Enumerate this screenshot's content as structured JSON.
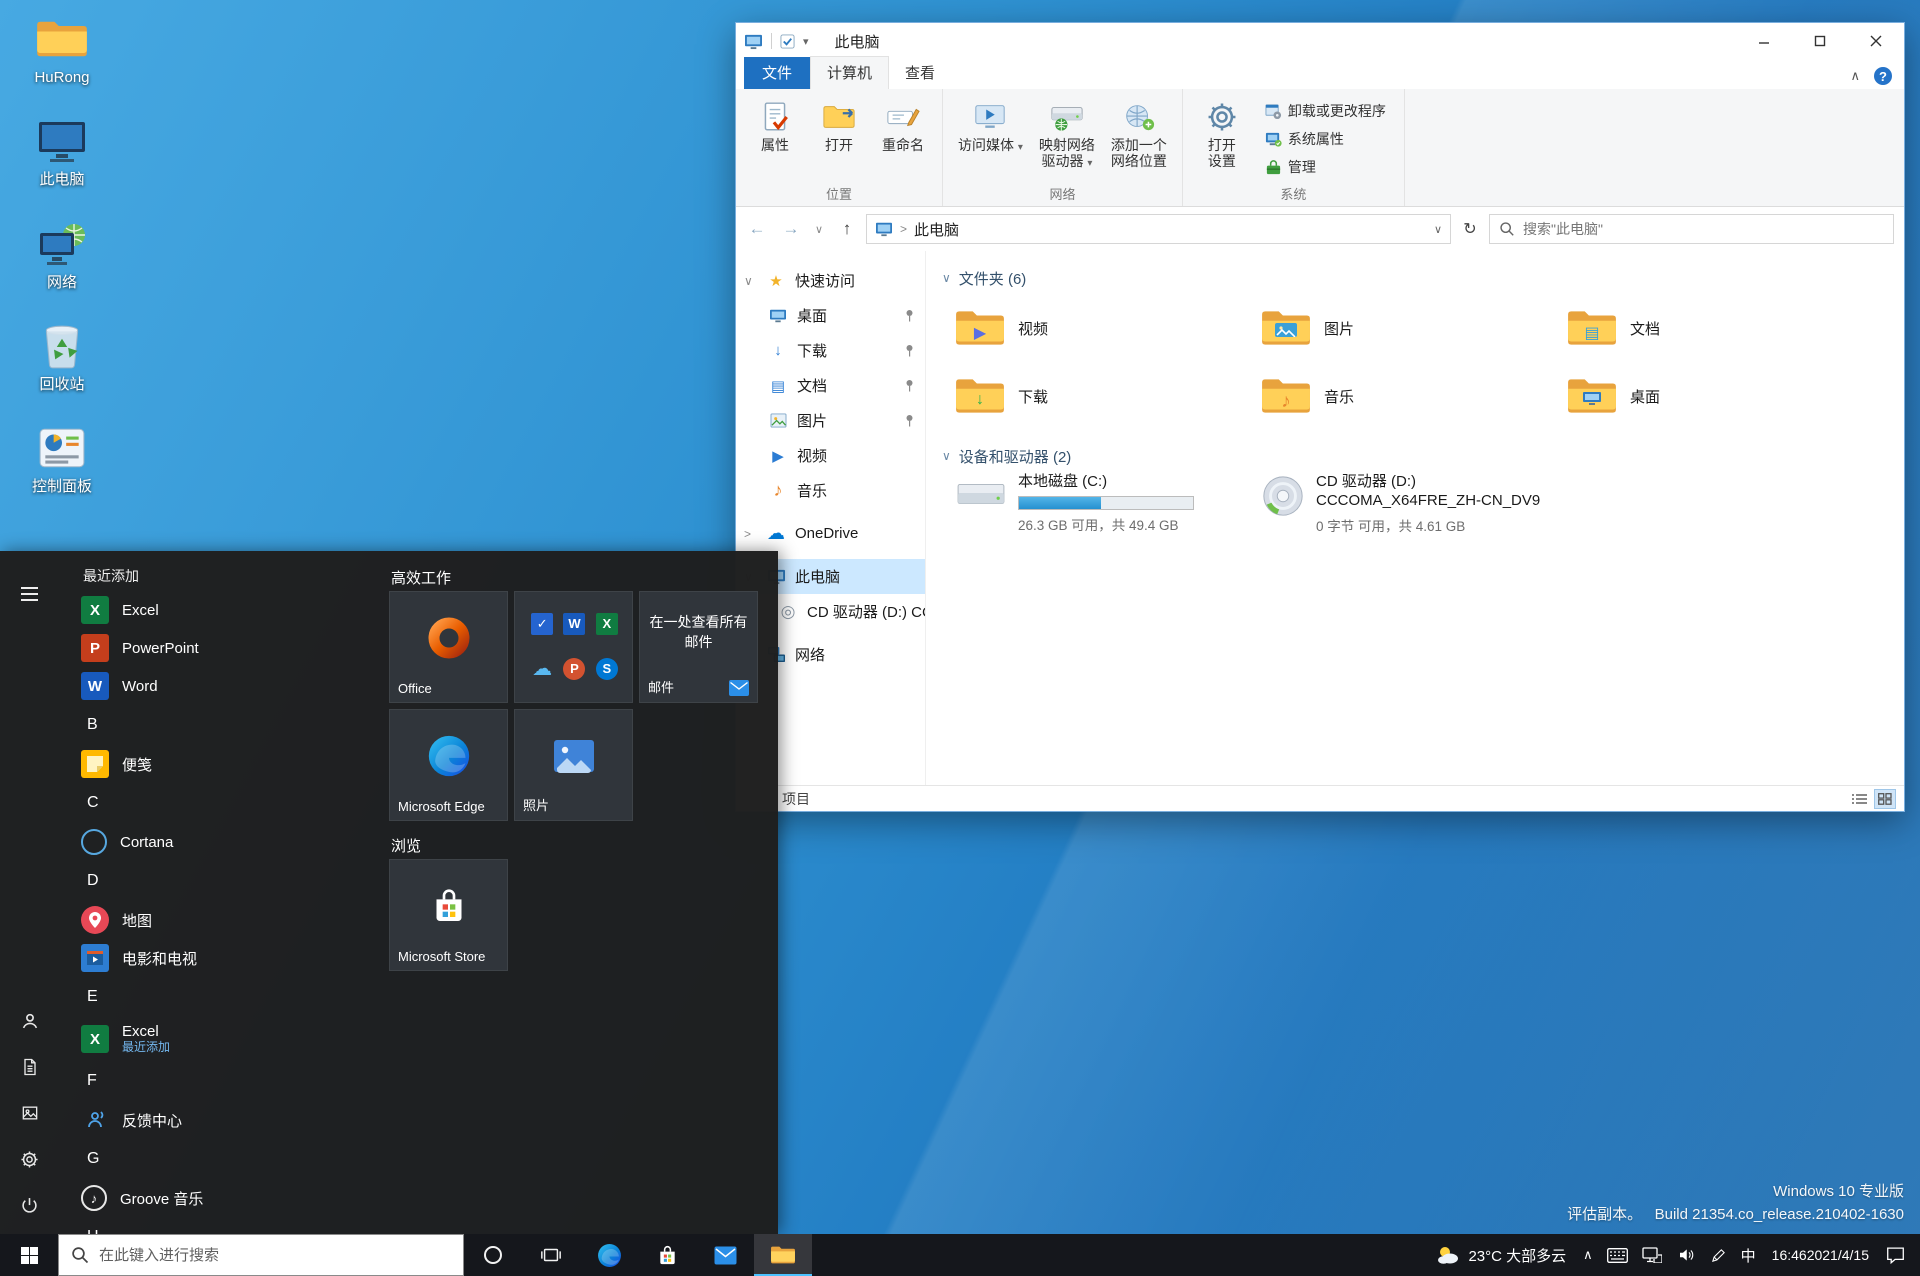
{
  "colors": {
    "accent_blue": "#0078d7",
    "desktop_blue": "#2f92d2",
    "file_tab_blue": "#1e70c1",
    "drive_bar_blue": "#2590d0",
    "folder_yellow": "#ffd058",
    "start_menu_bg": "#1e1e1e",
    "taskbar_bg": "#15171c",
    "taskbar_active_underline": "#4cc2ff"
  },
  "glyphs": {
    "back": "←",
    "forward": "→",
    "up": "↑",
    "refresh": "↻",
    "dropdown": "▾",
    "chev_down": "∨",
    "chev_right": ">",
    "ribbon_collapse": "∧",
    "help": "?",
    "tray_overflow": "∧",
    "play": "▶",
    "down": "↓",
    "music": "♪",
    "doc": "▤",
    "cd": "◎",
    "star": "★",
    "cloud": "☁"
  },
  "desktop": {
    "icons": [
      {
        "label": "HuRong"
      },
      {
        "label": "此电脑"
      },
      {
        "label": "网络"
      },
      {
        "label": "回收站"
      },
      {
        "label": "控制面板"
      }
    ],
    "winver": {
      "line1": "Windows 10 专业版",
      "line2a": "评估副本。",
      "line2b": "Build 21354.co_release.210402-1630"
    }
  },
  "explorer": {
    "title": "此电脑",
    "tabs": {
      "file": "文件",
      "computer": "计算机",
      "view": "查看"
    },
    "ribbon": {
      "properties": "属性",
      "open": "打开",
      "rename": "重命名",
      "group_location": "位置",
      "access_media": "访问媒体",
      "map_drive_l1": "映射网络",
      "map_drive_l2": "驱动器",
      "add_network_l1": "添加一个",
      "add_network_l2": "网络位置",
      "group_network": "网络",
      "open_settings_l1": "打开",
      "open_settings_l2": "设置",
      "uninstall": "卸载或更改程序",
      "system_properties": "系统属性",
      "manage": "管理",
      "group_system": "系统"
    },
    "address": {
      "crumb": "此电脑",
      "search_placeholder": "搜索\"此电脑\""
    },
    "nav": {
      "quick_access": "快速访问",
      "desktop": "桌面",
      "downloads": "下载",
      "documents": "文档",
      "pictures": "图片",
      "videos": "视频",
      "music": "音乐",
      "onedrive": "OneDrive",
      "this_pc": "此电脑",
      "cd_drive": "CD 驱动器 (D:) CCC",
      "network": "网络"
    },
    "section_folders": "文件夹 (6)",
    "section_devices": "设备和驱动器 (2)",
    "folders": [
      "视频",
      "图片",
      "文档",
      "下载",
      "音乐",
      "桌面"
    ],
    "drive_c": {
      "name": "本地磁盘 (C:)",
      "detail": "26.3 GB 可用，共 49.4 GB",
      "usage_percent": 47
    },
    "drive_d": {
      "name_l1": "CD 驱动器 (D:)",
      "name_l2": "CCCOMA_X64FRE_ZH-CN_DV9",
      "detail": "0 字节 可用，共 4.61 GB"
    },
    "status_items": "项目"
  },
  "start": {
    "recent_header": "最近添加",
    "recent_apps": [
      {
        "label": "Excel"
      },
      {
        "label": "PowerPoint"
      },
      {
        "label": "Word"
      }
    ],
    "groups": [
      {
        "letter": "B",
        "apps": [
          {
            "label": "便笺"
          }
        ]
      },
      {
        "letter": "C",
        "apps": [
          {
            "label": "Cortana"
          }
        ]
      },
      {
        "letter": "D",
        "apps": [
          {
            "label": "地图"
          },
          {
            "label": "电影和电视"
          }
        ]
      },
      {
        "letter": "E",
        "apps": [
          {
            "label": "Excel",
            "sub": "最近添加"
          }
        ]
      },
      {
        "letter": "F",
        "apps": [
          {
            "label": "反馈中心"
          }
        ]
      },
      {
        "letter": "G",
        "apps": [
          {
            "label": "Groove 音乐"
          }
        ]
      },
      {
        "letter": "H",
        "apps": []
      }
    ],
    "tiles": {
      "group_productivity": "高效工作",
      "group_browse": "浏览",
      "office": "Office",
      "mail_text": "在一处查看所有邮件",
      "mail_label": "邮件",
      "edge": "Microsoft Edge",
      "photos": "照片",
      "store": "Microsoft Store",
      "mini_glyphs": [
        "✓",
        "W",
        "X",
        "☁",
        "P",
        "S"
      ]
    }
  },
  "taskbar": {
    "search_placeholder": "在此键入进行搜索",
    "weather": "23°C 大部多云",
    "ime": "中",
    "time": "16:46",
    "date": "2021/4/15"
  }
}
